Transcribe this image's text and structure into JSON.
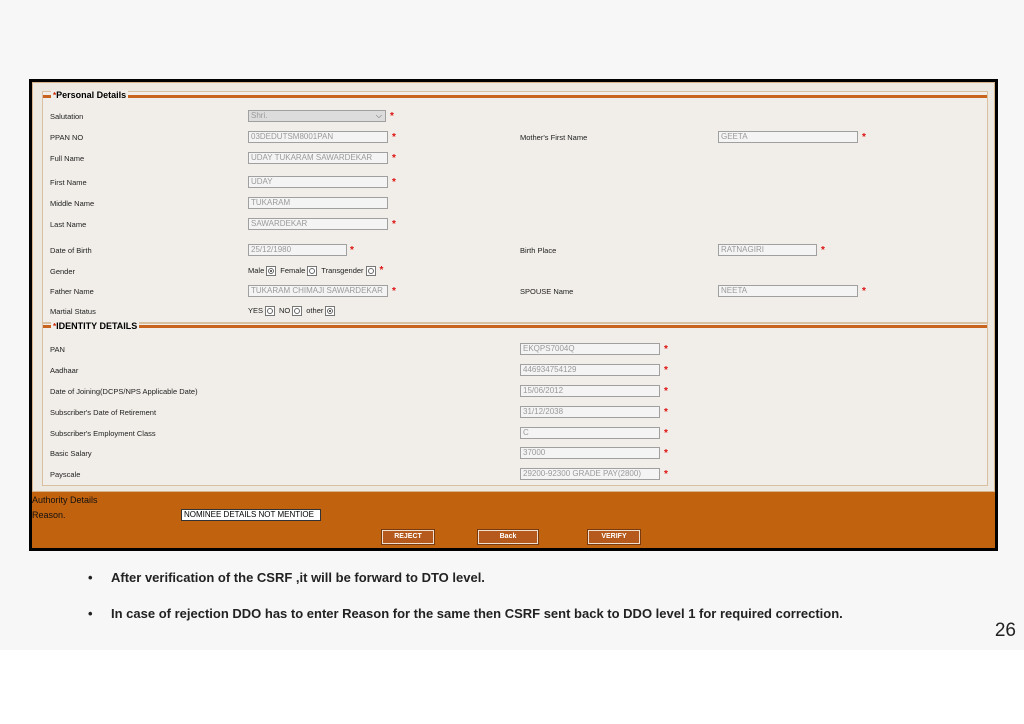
{
  "personal": {
    "legend": "Personal Details",
    "salutation_label": "Salutation",
    "salutation_value": "Shri.",
    "ppan_label": "PPAN NO",
    "ppan_value": "03DEDUTSM8001PAN",
    "mother_label": "Mother's First Name",
    "mother_value": "GEETA",
    "fullname_label": "Full Name",
    "fullname_value": "UDAY TUKARAM SAWARDEKAR",
    "firstname_label": "First Name",
    "firstname_value": "UDAY",
    "middlename_label": "Middle Name",
    "middlename_value": "TUKARAM",
    "lastname_label": "Last Name",
    "lastname_value": "SAWARDEKAR",
    "dob_label": "Date of Birth",
    "dob_value": "25/12/1980",
    "birthplace_label": "Birth Place",
    "birthplace_value": "RATNAGIRI",
    "gender_label": "Gender",
    "gender_male": "Male",
    "gender_female": "Female",
    "gender_trans": "Transgender",
    "father_label": "Father Name",
    "father_value": "TUKARAM CHIMAJI SAWARDEKAR",
    "spouse_label": "SPOUSE Name",
    "spouse_value": "NEETA",
    "marital_label": "Martial Status",
    "marital_yes": "YES",
    "marital_no": "NO",
    "marital_other": "other"
  },
  "identity": {
    "legend": "IDENTITY DETAILS",
    "pan_label": "PAN",
    "pan_value": "EKQPS7004Q",
    "aadhaar_label": "Aadhaar",
    "aadhaar_value": "446934754129",
    "doj_label": "Date of Joining(DCPS/NPS Applicable Date)",
    "doj_value": "15/06/2012",
    "retire_label": "Subscriber's Date of Retirement",
    "retire_value": "31/12/2038",
    "class_label": "Subscriber's Employment Class",
    "class_value": "C",
    "salary_label": "Basic Salary",
    "salary_value": "37000",
    "payscale_label": "Payscale",
    "payscale_value": "29200-92300 GRADE PAY(2800)"
  },
  "authority": {
    "title": "Authority Details",
    "reason_label": "Reason.",
    "reason_value": "NOMINEE DETAILS NOT MENTIOE"
  },
  "buttons": {
    "reject": "REJECT",
    "back": "Back",
    "verify": "VERIFY"
  },
  "required_mark": "*",
  "notes": [
    "After verification of the CSRF ,it will be forward to DTO level.",
    "In case of rejection DDO has to enter Reason for the same then CSRF sent back to DDO level 1 for required correction."
  ],
  "bullet_char": "•",
  "page_number": "26",
  "colors": {
    "accent": "#c1620e",
    "required": "#dd1111",
    "frame": "#000000"
  }
}
